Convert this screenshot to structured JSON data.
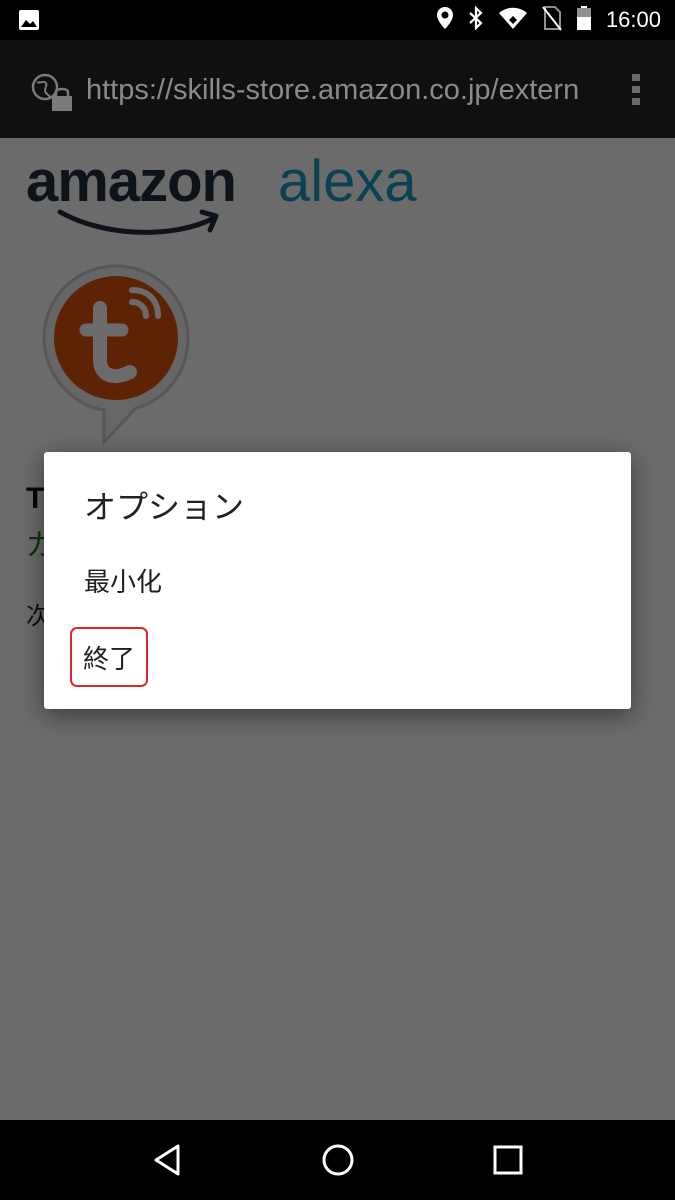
{
  "status_bar": {
    "time": "16:00",
    "icons": [
      "image-icon",
      "location-icon",
      "bluetooth-icon",
      "wifi-icon",
      "no-sim-icon",
      "battery-icon"
    ]
  },
  "browser": {
    "url": "https://skills-store.amazon.co.jp/extern"
  },
  "page": {
    "logo_amazon": "amazon",
    "logo_alexa": "alexa",
    "partial_title": "T",
    "partial_green": "ガ",
    "partial_text": "次"
  },
  "dialog": {
    "title": "オプション",
    "items": [
      {
        "label": "最小化"
      },
      {
        "label": "終了"
      }
    ]
  },
  "colors": {
    "alexa_blue": "#1b9dc2",
    "skill_orange": "#e0530e",
    "highlight_red": "#e0262b"
  }
}
